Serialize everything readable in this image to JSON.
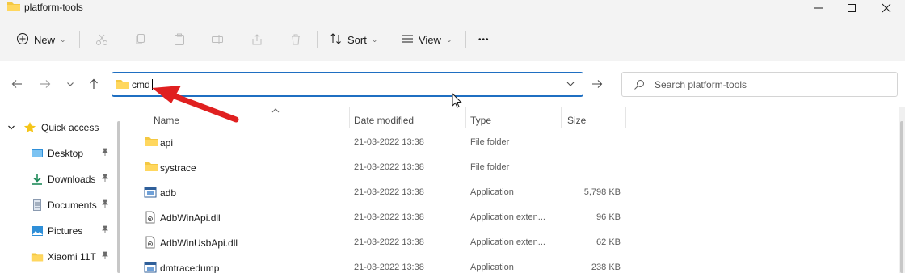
{
  "window": {
    "title": "platform-tools",
    "colors": {
      "accent": "#1f6fc2",
      "folder": "#f4c842",
      "arrow": "#e02020"
    }
  },
  "commandbar": {
    "new_label": "New",
    "sort_label": "Sort",
    "view_label": "View",
    "more_label": "•••"
  },
  "address": {
    "value": "cmd"
  },
  "search": {
    "placeholder": "Search platform-tools"
  },
  "sidebar": {
    "items": [
      {
        "label": "Quick access",
        "icon": "star-icon"
      },
      {
        "label": "Desktop",
        "icon": "desktop-icon",
        "pinned": true
      },
      {
        "label": "Downloads",
        "icon": "download-icon",
        "pinned": true
      },
      {
        "label": "Documents",
        "icon": "document-icon",
        "pinned": true
      },
      {
        "label": "Pictures",
        "icon": "pictures-icon",
        "pinned": true
      },
      {
        "label": "Xiaomi 11T",
        "icon": "folder-icon",
        "pinned": true
      }
    ]
  },
  "filelist": {
    "columns": {
      "name": "Name",
      "date": "Date modified",
      "type": "Type",
      "size": "Size"
    },
    "rows": [
      {
        "name": "api",
        "date": "21-03-2022 13:38",
        "type": "File folder",
        "size": "",
        "icon": "folder-icon"
      },
      {
        "name": "systrace",
        "date": "21-03-2022 13:38",
        "type": "File folder",
        "size": "",
        "icon": "folder-icon"
      },
      {
        "name": "adb",
        "date": "21-03-2022 13:38",
        "type": "Application",
        "size": "5,798 KB",
        "icon": "application-icon"
      },
      {
        "name": "AdbWinApi.dll",
        "date": "21-03-2022 13:38",
        "type": "Application exten...",
        "size": "96 KB",
        "icon": "dll-file-icon"
      },
      {
        "name": "AdbWinUsbApi.dll",
        "date": "21-03-2022 13:38",
        "type": "Application exten...",
        "size": "62 KB",
        "icon": "dll-file-icon"
      },
      {
        "name": "dmtracedump",
        "date": "21-03-2022 13:38",
        "type": "Application",
        "size": "238 KB",
        "icon": "application-icon"
      }
    ]
  }
}
